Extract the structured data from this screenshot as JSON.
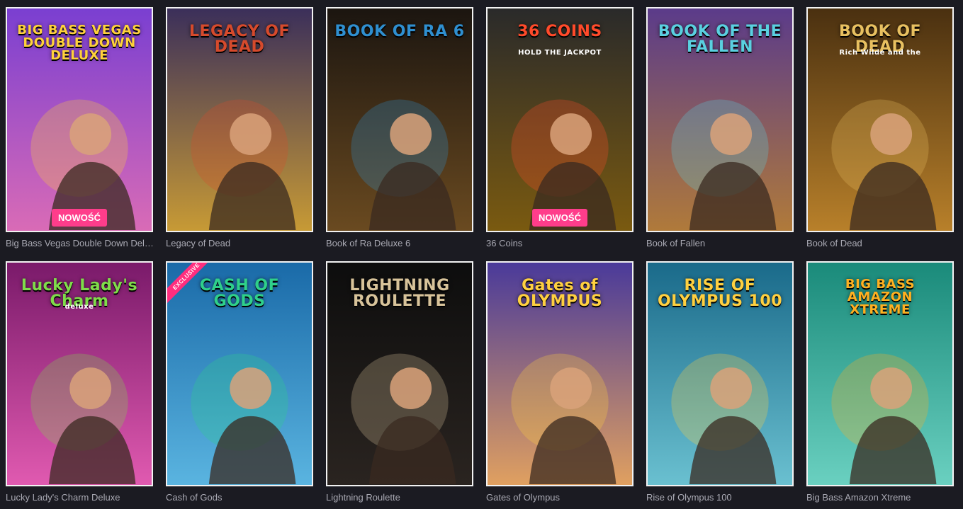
{
  "games": [
    {
      "label": "Big Bass Vegas Double Down Deluxe",
      "art_title": "BIG BASS VEGAS DOUBLE DOWN DELUXE",
      "badge": "NOWOŚĆ",
      "bg": [
        "#7a3fd1",
        "#d96bb6"
      ],
      "accent": "#ffd23a"
    },
    {
      "label": "Legacy of Dead",
      "art_title": "LEGACY OF DEAD",
      "badge": "",
      "bg": [
        "#3b2f5a",
        "#c79a35"
      ],
      "accent": "#d64a2c"
    },
    {
      "label": "Book of Ra Deluxe 6",
      "art_title": "BOOK OF RA 6",
      "badge": "",
      "bg": [
        "#1b1510",
        "#6a4a20"
      ],
      "accent": "#2f8fd0"
    },
    {
      "label": "36 Coins",
      "art_title": "36 COINS",
      "badge": "NOWOŚĆ",
      "bg": [
        "#2a2a2a",
        "#7a5a10"
      ],
      "accent": "#ff4a2a",
      "art_sub": "HOLD THE JACKPOT"
    },
    {
      "label": "Book of Fallen",
      "art_title": "BOOK OF THE FALLEN",
      "badge": "",
      "bg": [
        "#5b3b8a",
        "#b07a3a"
      ],
      "accent": "#5ad0e0"
    },
    {
      "label": "Book of Dead",
      "art_title": "BOOK OF DEAD",
      "badge": "",
      "bg": [
        "#4a3010",
        "#b8802a"
      ],
      "accent": "#e8c060",
      "art_sub": "Rich Wilde and the"
    },
    {
      "label": "Lucky Lady's Charm Deluxe",
      "art_title": "Lucky Lady's Charm",
      "badge": "",
      "bg": [
        "#7a1a6a",
        "#e05ab0"
      ],
      "accent": "#7fdc4a",
      "art_sub": "deluxe"
    },
    {
      "label": "Cash of Gods",
      "art_title": "CASH OF GODS",
      "badge": "",
      "exclusive": "EXCLUSIVE",
      "bg": [
        "#1a6aa8",
        "#5ab4e0"
      ],
      "accent": "#2fd08a"
    },
    {
      "label": "Lightning Roulette",
      "art_title": "LIGHTNING ROULETTE",
      "badge": "",
      "bg": [
        "#0d0d0d",
        "#2a2420"
      ],
      "accent": "#d8c39a"
    },
    {
      "label": "Gates of Olympus",
      "art_title": "Gates of OLYMPUS",
      "badge": "",
      "bg": [
        "#4a3a9a",
        "#e0a060"
      ],
      "accent": "#ffd040"
    },
    {
      "label": "Rise of Olympus 100",
      "art_title": "RISE OF OLYMPUS 100",
      "badge": "",
      "bg": [
        "#1a6a8a",
        "#6ac0d0"
      ],
      "accent": "#ffd040"
    },
    {
      "label": "Big Bass Amazon Xtreme",
      "art_title": "BIG BASS AMAZON XTREME",
      "badge": "",
      "bg": [
        "#1a8a7a",
        "#6ad0c0"
      ],
      "accent": "#ffb020"
    }
  ]
}
